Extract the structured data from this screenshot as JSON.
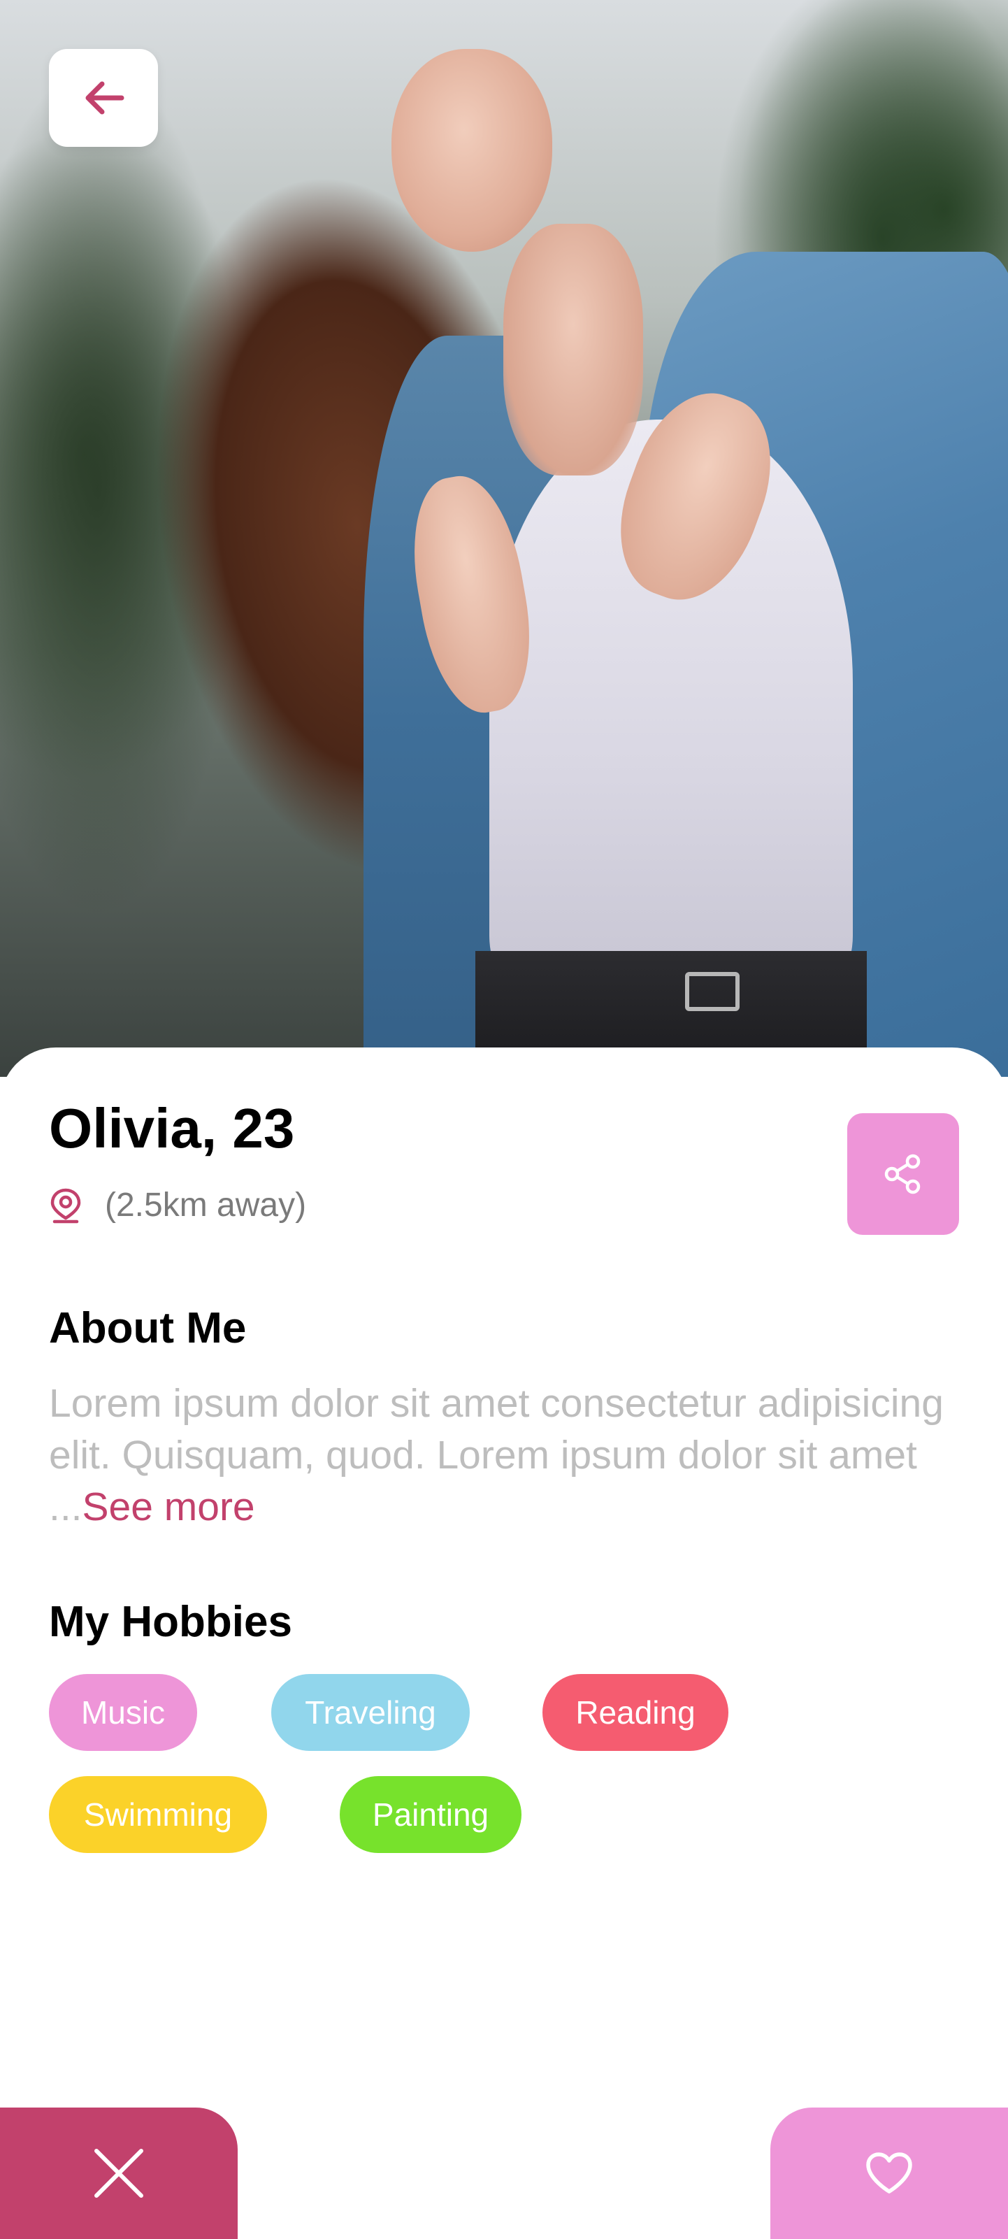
{
  "profile": {
    "name_age": "Olivia, 23",
    "distance": "(2.5km away)"
  },
  "about": {
    "title": "About Me",
    "text": "Lorem ipsum dolor sit amet consectetur adipisicing elit. Quisquam, quod. Lorem ipsum dolor sit amet ...",
    "see_more": "See more"
  },
  "hobbies": {
    "title": "My Hobbies",
    "items": [
      {
        "label": "Music",
        "color": "#ee95d8"
      },
      {
        "label": "Traveling",
        "color": "#91d6ec"
      },
      {
        "label": "Reading",
        "color": "#f55c70"
      },
      {
        "label": "Swimming",
        "color": "#fbd229"
      },
      {
        "label": "Painting",
        "color": "#77e22c"
      }
    ]
  },
  "icons": {
    "back": "arrow-left-icon",
    "location": "location-pin-icon",
    "share": "share-icon",
    "reject": "close-icon",
    "like": "heart-icon"
  },
  "colors": {
    "accent": "#c2416c",
    "pink": "#ee95d8",
    "muted_text": "#bdbdbd",
    "secondary_text": "#7a7a7a"
  }
}
